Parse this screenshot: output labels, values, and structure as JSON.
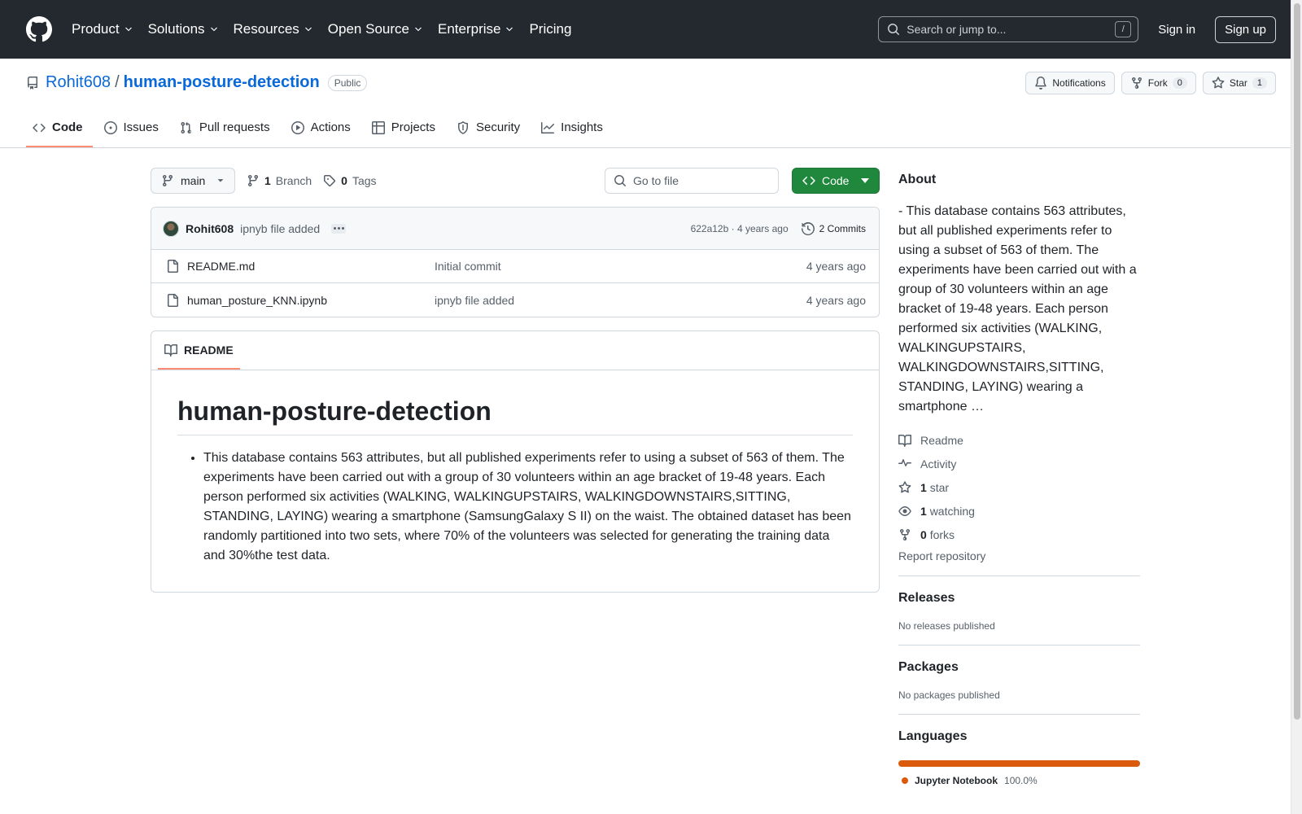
{
  "nav": {
    "items": [
      "Product",
      "Solutions",
      "Resources",
      "Open Source",
      "Enterprise",
      "Pricing"
    ],
    "search_placeholder": "Search or jump to...",
    "search_shortcut": "/",
    "signin": "Sign in",
    "signup": "Sign up"
  },
  "repo": {
    "owner": "Rohit608",
    "separator": "/",
    "name": "human-posture-detection",
    "visibility": "Public",
    "notifications_label": "Notifications",
    "fork_label": "Fork",
    "fork_count": "0",
    "star_label": "Star",
    "star_count": "1",
    "tabs": [
      "Code",
      "Issues",
      "Pull requests",
      "Actions",
      "Projects",
      "Security",
      "Insights"
    ]
  },
  "file_nav": {
    "branch": "main",
    "branch_count": "1",
    "branch_label": "Branch",
    "tag_count": "0",
    "tag_label": "Tags",
    "goto_placeholder": "Go to file",
    "code_button": "Code"
  },
  "commit": {
    "author": "Rohit608",
    "message": "ipnyb file added",
    "sha_time": "622a12b · 4 years ago",
    "commits_label": "2 Commits"
  },
  "files": [
    {
      "name": "README.md",
      "message": "Initial commit",
      "age": "4 years ago"
    },
    {
      "name": "human_posture_KNN.ipynb",
      "message": "ipnyb file added",
      "age": "4 years ago"
    }
  ],
  "readme": {
    "tab_label": "README",
    "title": "human-posture-detection",
    "bullet": "This database contains 563 attributes, but all published experiments refer to using a subset of 563 of them. The experiments have been carried out with a group of 30 volunteers within an age bracket of 19-48 years. Each person performed six activities (WALKING, WALKINGUPSTAIRS, WALKINGDOWNSTAIRS,SITTING, STANDING, LAYING) wearing a smartphone (SamsungGalaxy S II) on the waist. The obtained dataset has been randomly partitioned into two sets, where 70% of the volunteers was selected for generating the training data and 30%the test data."
  },
  "about": {
    "heading": "About",
    "description": "- This database contains 563 attributes, but all published experiments refer to using a subset of 563 of them. The experiments have been carried out with a group of 30 volunteers within an age bracket of 19-48 years. Each person performed six activities (WALKING, WALKINGUPSTAIRS, WALKINGDOWNSTAIRS,SITTING, STANDING, LAYING) wearing a smartphone …",
    "readme": "Readme",
    "activity": "Activity",
    "stars_count": "1",
    "stars_label": "star",
    "watching_count": "1",
    "watching_label": "watching",
    "forks_count": "0",
    "forks_label": "forks",
    "report": "Report repository"
  },
  "releases": {
    "heading": "Releases",
    "empty": "No releases published"
  },
  "packages": {
    "heading": "Packages",
    "empty": "No packages published"
  },
  "languages": {
    "heading": "Languages",
    "items": [
      {
        "name": "Jupyter Notebook",
        "percent": "100.0%",
        "fraction": 1.0,
        "color": "#DA5B0B"
      }
    ]
  }
}
